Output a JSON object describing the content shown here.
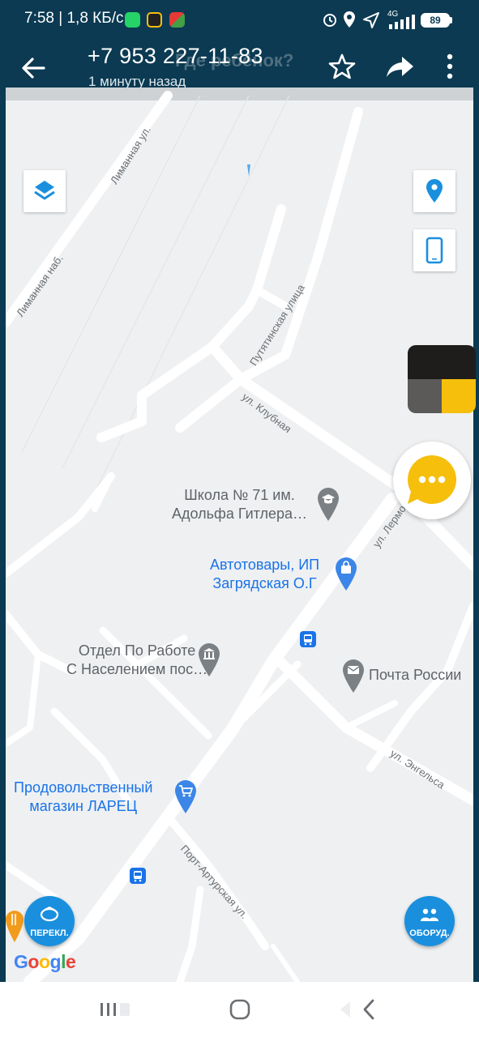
{
  "status_bar": {
    "time": "7:58 | 1,8 КБ/с",
    "battery": "89",
    "network": "4G"
  },
  "header": {
    "title": "+7 953 227-11-83",
    "subtitle": "1 минуту назад",
    "background_title": "Где ребёнок?"
  },
  "map": {
    "streets": {
      "limannaya_ul": "Лиманная ул.",
      "limannaya_nab": "Лиманная наб.",
      "putyatinskaya": "Путятинская улица",
      "klubnaya": "ул. Клубная",
      "lermontova": "ул. Лермо",
      "engelsa": "ул. Энгельса",
      "port_arturskaya": "Порт-Артурская ул."
    },
    "pois": [
      {
        "name_line1": "Школа № 71 им.",
        "name_line2": "Адольфа Гитлера…",
        "icon": "graduation-cap-icon",
        "color": "#70757a"
      },
      {
        "name_line1": "Автотовары, ИП",
        "name_line2": "Загрядская О.Г",
        "icon": "shopping-bag-icon",
        "color": "#1a73e8"
      },
      {
        "name_line1": "Отдел По Работе",
        "name_line2": "С Населением пос…",
        "icon": "government-icon",
        "color": "#70757a"
      },
      {
        "name_line1": "Почта России",
        "name_line2": "",
        "icon": "mail-icon",
        "color": "#70757a"
      },
      {
        "name_line1": "Продовольственный",
        "name_line2": "магазин ЛАРЕЦ",
        "icon": "shopping-cart-icon",
        "color": "#1a73e8"
      }
    ],
    "buttons": {
      "switch_label": "ПЕРЕКЛ.",
      "device_label": "ОБОРУД."
    },
    "google_logo": "Google"
  },
  "colors": {
    "header_bg": "#0b3a52",
    "map_bg": "#eef0f2",
    "road": "#ffffff",
    "accent_blue": "#1a8fde",
    "chat_yellow": "#f5bf0c",
    "poi_blue": "#1a73e8",
    "poi_grey": "#70757a"
  }
}
